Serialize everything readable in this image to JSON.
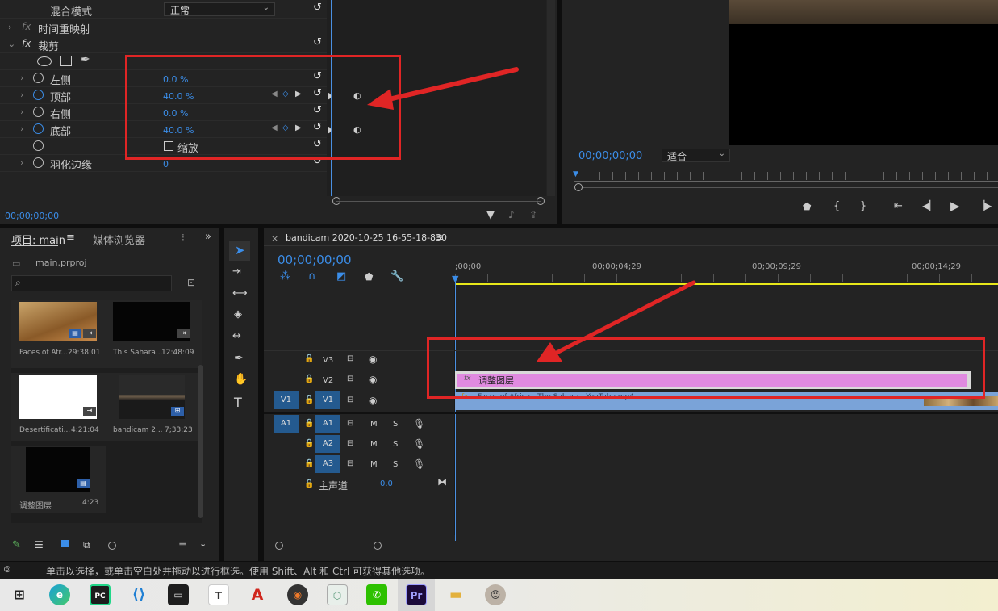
{
  "effect_controls": {
    "blend_mode_label": "混合模式",
    "blend_mode_value": "正常",
    "time_remap_label": "时间重映射",
    "fx": "fx",
    "crop_label": "裁剪",
    "left_label": "左侧",
    "left_value": "0.0 %",
    "top_label": "顶部",
    "top_value": "40.0 %",
    "right_label": "右侧",
    "right_value": "0.0 %",
    "bottom_label": "底部",
    "bottom_value": "40.0 %",
    "zoom_label": "缩放",
    "feather_label": "羽化边缘",
    "feather_value": "0",
    "timecode": "00;00;00;00"
  },
  "program_monitor": {
    "timecode": "00;00;00;00",
    "fit_value": "适合"
  },
  "project_panel": {
    "tab_project": "项目: main",
    "tab_media": "媒体浏览器",
    "file_name": "main.prproj",
    "items": [
      {
        "name": "Faces of Afr...",
        "duration": "29:38:01"
      },
      {
        "name": "This Sahara...",
        "duration": "12:48:09"
      },
      {
        "name": "Desertificati...",
        "duration": "4:21:04"
      },
      {
        "name": "bandicam 2...",
        "duration": "7;33;23"
      },
      {
        "name": "调整图层",
        "duration": "4:23"
      }
    ]
  },
  "timeline": {
    "sequence_name": "bandicam 2020-10-25 16-55-18-830",
    "timecode": "00;00;00;00",
    "ruler": [
      ";00;00",
      "00;00;04;29",
      "00;00;09;29",
      "00;00;14;29"
    ],
    "tracks": {
      "v3": "V3",
      "v2": "V2",
      "v1": "V1",
      "a1": "A1",
      "a2": "A2",
      "a3": "A3"
    },
    "mute": "M",
    "solo": "S",
    "master_label": "主声道",
    "master_value": "0.0",
    "adjustment_clip": "调整图层",
    "video_clip": "Faces of Africa - The Sahara - YouTube.mp4"
  },
  "status_text": "单击以选择，或单击空白处并拖动以进行框选。使用 Shift、Alt 和 Ctrl 可获得其他选项。",
  "taskbar_icons": [
    "windows-start-icon",
    "edge-icon",
    "pycharm-icon",
    "vscode-icon",
    "terminal-icon",
    "typora-icon",
    "acrobat-icon",
    "music-icon",
    "app-icon",
    "wechat-icon",
    "premiere-icon",
    "files-icon",
    "avatar-icon"
  ],
  "colors": {
    "accent": "#3b8de8",
    "annotation": "#e02525",
    "adjustment_clip": "#e08ae0",
    "track_blue": "#245a8f"
  }
}
